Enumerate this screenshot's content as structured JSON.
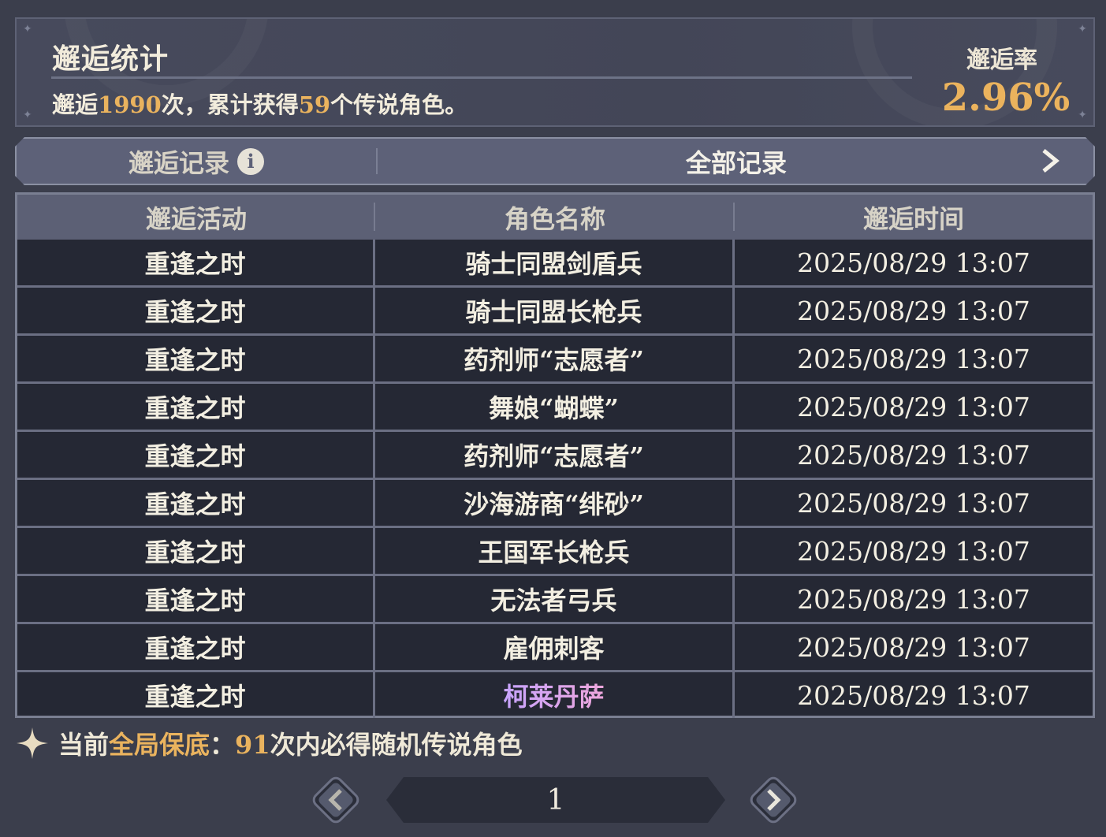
{
  "stats": {
    "title": "邂逅统计",
    "summary_prefix": "邂逅",
    "total_encounters": "1990",
    "summary_mid": "次，累计获得",
    "legendary_count": "59",
    "summary_suffix": "个传说角色。",
    "rate_label": "邂逅率",
    "rate_value": "2.96%"
  },
  "records_bar": {
    "tab_label": "邂逅记录",
    "info_icon": "i",
    "filter_label": "全部记录"
  },
  "table": {
    "headers": [
      "邂逅活动",
      "角色名称",
      "邂逅时间"
    ],
    "rows": [
      {
        "activity": "重逢之时",
        "character": "骑士同盟剑盾兵",
        "time": "2025/08/29 13:07"
      },
      {
        "activity": "重逢之时",
        "character": "骑士同盟长枪兵",
        "time": "2025/08/29 13:07"
      },
      {
        "activity": "重逢之时",
        "character": "药剂师“志愿者”",
        "time": "2025/08/29 13:07"
      },
      {
        "activity": "重逢之时",
        "character": "舞娘“蝴蝶”",
        "time": "2025/08/29 13:07"
      },
      {
        "activity": "重逢之时",
        "character": "药剂师“志愿者”",
        "time": "2025/08/29 13:07"
      },
      {
        "activity": "重逢之时",
        "character": "沙海游商“绯砂”",
        "time": "2025/08/29 13:07"
      },
      {
        "activity": "重逢之时",
        "character": "王国军长枪兵",
        "time": "2025/08/29 13:07"
      },
      {
        "activity": "重逢之时",
        "character": "无法者弓兵",
        "time": "2025/08/29 13:07"
      },
      {
        "activity": "重逢之时",
        "character": "雇佣刺客",
        "time": "2025/08/29 13:07"
      },
      {
        "activity": "重逢之时",
        "character": "柯莱丹萨",
        "time": "2025/08/29 13:07",
        "legendary": true
      }
    ]
  },
  "pity": {
    "prefix": "当前",
    "highlight": "全局保底",
    "colon": "：",
    "count": "91",
    "suffix": "次内必得随机传说角色"
  },
  "pagination": {
    "current_page": "1"
  },
  "colors": {
    "background": "#3b3e4c",
    "accent_gold": "#eab35e",
    "header_bar": "#5c6075",
    "row_bg": "#252834"
  },
  "icons": {
    "info": "info-icon",
    "filter_arrow": "chevron-right-icon",
    "pity": "sparkle-star-icon",
    "prev": "chevron-left-icon",
    "next": "chevron-right-icon"
  }
}
